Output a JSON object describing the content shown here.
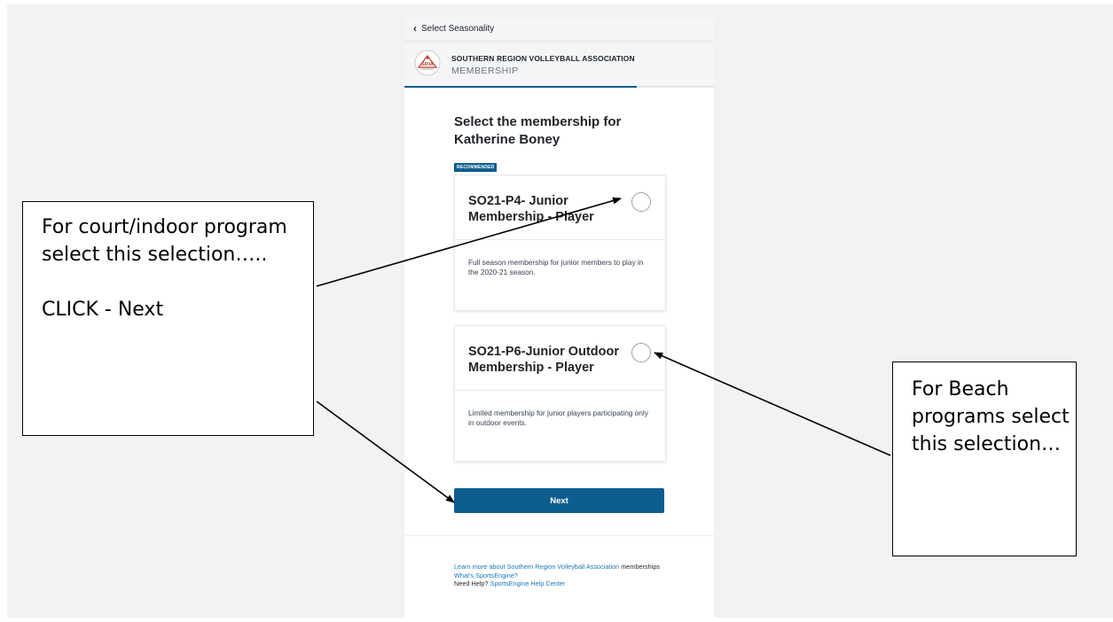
{
  "topbar": {
    "back_label": "Select Seasonality"
  },
  "org": {
    "logo_text": "SRVA",
    "name": "SOUTHERN REGION VOLLEYBALL ASSOCIATION",
    "section": "MEMBERSHIP"
  },
  "progress": 0.75,
  "heading": "Select the membership for Katherine Boney",
  "badge": "RECOMMENDED",
  "options": [
    {
      "title": "SO21-P4- Junior Membership - Player",
      "description": "Full season membership for junior members to play in the 2020-21 season.",
      "selected": false
    },
    {
      "title": "SO21-P6-Junior Outdoor Membership - Player",
      "description": "Limited membership for junior players participating only in outdoor events.",
      "selected": false
    }
  ],
  "next_label": "Next",
  "footer": {
    "learn_more_link": "Learn more about Southern Region Volleyball Association",
    "learn_more_suffix": " memberships",
    "whats_link": "What's SportsEngine?",
    "help_prefix": "Need Help? ",
    "help_link": "SportsEngine Help Center"
  },
  "callouts": {
    "left": "For court/indoor program select this selection…..\n\nCLICK - Next",
    "right": "For Beach programs select this selection…"
  },
  "colors": {
    "primary": "#0d5e8f",
    "link": "#1a78b8",
    "background": "#f1f2f4"
  }
}
